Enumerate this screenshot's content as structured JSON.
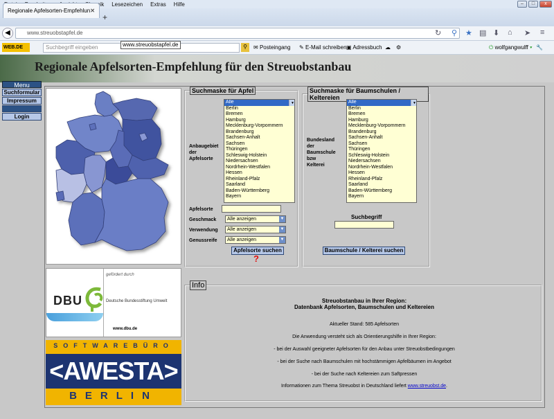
{
  "browser": {
    "menu": [
      "Datei",
      "Bearbeiten",
      "Ansicht",
      "Chronik",
      "Lesezeichen",
      "Extras",
      "Hilfe"
    ],
    "window_controls": [
      "–",
      "□",
      "x"
    ],
    "tab_title": "Regionale Apfelsorten-Empfehlun...",
    "new_tab": "+",
    "url": "www.streuobstapfel.de",
    "tooltip": "www.streuobstapfel.de",
    "toolbar": {
      "brand": "WEB.DE",
      "search_placeholder": "Suchbegriff eingeben",
      "posteingang": "Posteingang",
      "email_schreiben": "E-Mail schreiben",
      "adressbuch": "Adressbuch",
      "user": "wolfgangwulff"
    }
  },
  "page": {
    "title": "Regionale Apfelsorten-Empfehlung für den Streuobstanbau",
    "menu": {
      "heading": "Menu",
      "items": [
        "Suchformular",
        "Impressum",
        "Login"
      ]
    },
    "dbu": {
      "sponsor_text": "gefördert durch",
      "logo": "DBU",
      "name": "Deutsche Bundesstiftung Umwelt",
      "url": "www.dbu.de"
    },
    "awesta": {
      "top": "SOFTWAREBÜRO",
      "logo": "<AWESTA>",
      "bottom": "BERLIN"
    },
    "apfel_search": {
      "legend": "Suchmaske für Apfel",
      "region_label": [
        "Anbaugebiet",
        "der",
        "Apfelsorte"
      ],
      "apfelsorte_label": "Apfelsorte",
      "geschmack_label": "Geschmack",
      "verwendung_label": "Verwendung",
      "genussreife_label": "Genussreife",
      "select_value": "Alle anzeigen",
      "button": "Apfelsorte suchen",
      "help": "?"
    },
    "baumschule_search": {
      "legend": "Suchmaske für Baumschulen / Keltereien",
      "region_label": [
        "Bundesland",
        "der",
        "Baumschule",
        "bzw",
        "Kelterei"
      ],
      "suchbegriff_label": "Suchbegriff",
      "button": "Baumschule / Kelterei suchen"
    },
    "regions": [
      "Alle",
      "Berlin",
      "Bremen",
      "Hamburg",
      "Mecklenburg-Vorpommern",
      "Brandenburg",
      "Sachsen-Anhalt",
      "Sachsen",
      "Thüringen",
      "Schleswig-Holstein",
      "Niedersachsen",
      "Nordrhein-Westfalen",
      "Hessen",
      "Rheinland-Pfalz",
      "Saarland",
      "Baden-Württemberg",
      "Bayern"
    ],
    "info": {
      "legend": "Info",
      "heading1": "Streuobstanbau in Ihrer Region:",
      "heading2": "Datenbank Apfelsorten, Baumschulen und Keltereien",
      "stand": "Aktueller Stand: 585 Apfelsorten",
      "intro": "Die Anwendung versteht sich als Orientierungshilfe in Ihrer Region:",
      "point1": "- bei der Auswahl geeigneter Apfelsorten für den Anbau unter Streuobstbedingungen",
      "point2": "- bei der Suche nach Baumschulen mit hochstämmigen Apfelbäumen im Angebot",
      "point3": "- bei der Suche nach Keltereien zum Saftpressen",
      "footer_text": "Informationen zum Thema Streuobst in Deutschland liefert",
      "footer_link": "www.streuobst.de",
      "footer_end": "."
    }
  }
}
